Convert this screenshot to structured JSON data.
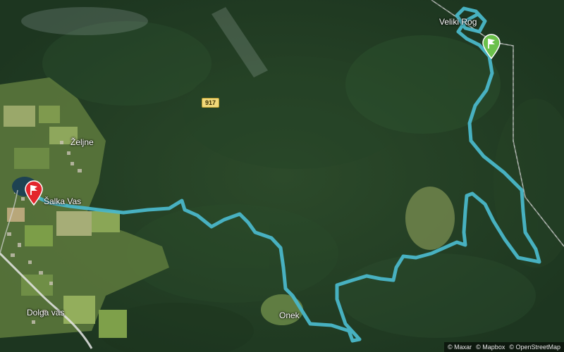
{
  "map": {
    "road_number": "917",
    "places": {
      "veliki_rog": "Veliki Rog",
      "zeljne": "Željne",
      "salka_vas": "Šalka Vas",
      "onek": "Onek",
      "dolga_vas": "Dolga vas"
    },
    "route": {
      "color": "#4ab7c9",
      "start_marker_color": "#6bc04b",
      "end_marker_color": "#e3262d"
    },
    "attribution": [
      "© Maxar",
      "© Mapbox",
      "© OpenStreetMap"
    ]
  }
}
